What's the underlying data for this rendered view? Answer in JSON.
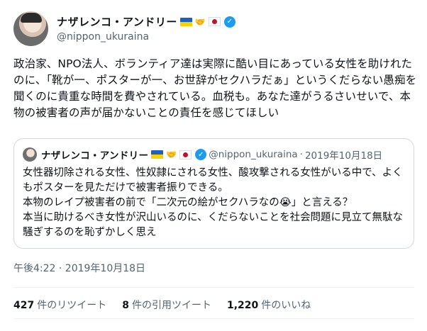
{
  "author": {
    "display_name": "ナザレンコ・アンドリー",
    "handle": "@nippon_ukuraina",
    "hands_icon": "🤝",
    "flags": [
      "ukraine-flag",
      "japan-flag"
    ]
  },
  "tweet": {
    "text": "政治家、NPO法人、ボランティア達は実際に酷い目にあっている女性を助けれたのに、「靴が一、ポスターが一、お世辞がセクハラだぁ」というくだらない愚痴を聞くのに貴重な時間を費やされている。血税も。あなた達がうるさいせいで、本物の被害者の声が届かないことの責任を感じてほしい",
    "timestamp": "午後4:22 · 2019年10月18日"
  },
  "quote": {
    "display_name": "ナザレンコ・アンドリー",
    "handle": "@nippon_ukuraina",
    "dot": "·",
    "date": "2019年10月18日",
    "text": "女性器切除される女性、性奴隷にされる女性、酸攻撃される女性がいる中で、よくもポスターを見ただけで被害者振りできる。\n本物のレイプ被害者の前で「二次元の絵がセクハラなの😭」と言える？\n本当に助けるべき女性が沢山いるのに、くだらないことを社会問題に見立て無駄な騒ぎするのを恥ずかしく思え"
  },
  "stats": {
    "retweets_count": "427",
    "retweets_label": "件のリツイート",
    "quotes_count": "8",
    "quotes_label": "件の引用ツイート",
    "likes_count": "1,220",
    "likes_label": "件のいいね"
  },
  "colors": {
    "text": "#0f1419",
    "secondary": "#536471",
    "verified": "#1d9bf0",
    "border": "#cfd9de"
  }
}
